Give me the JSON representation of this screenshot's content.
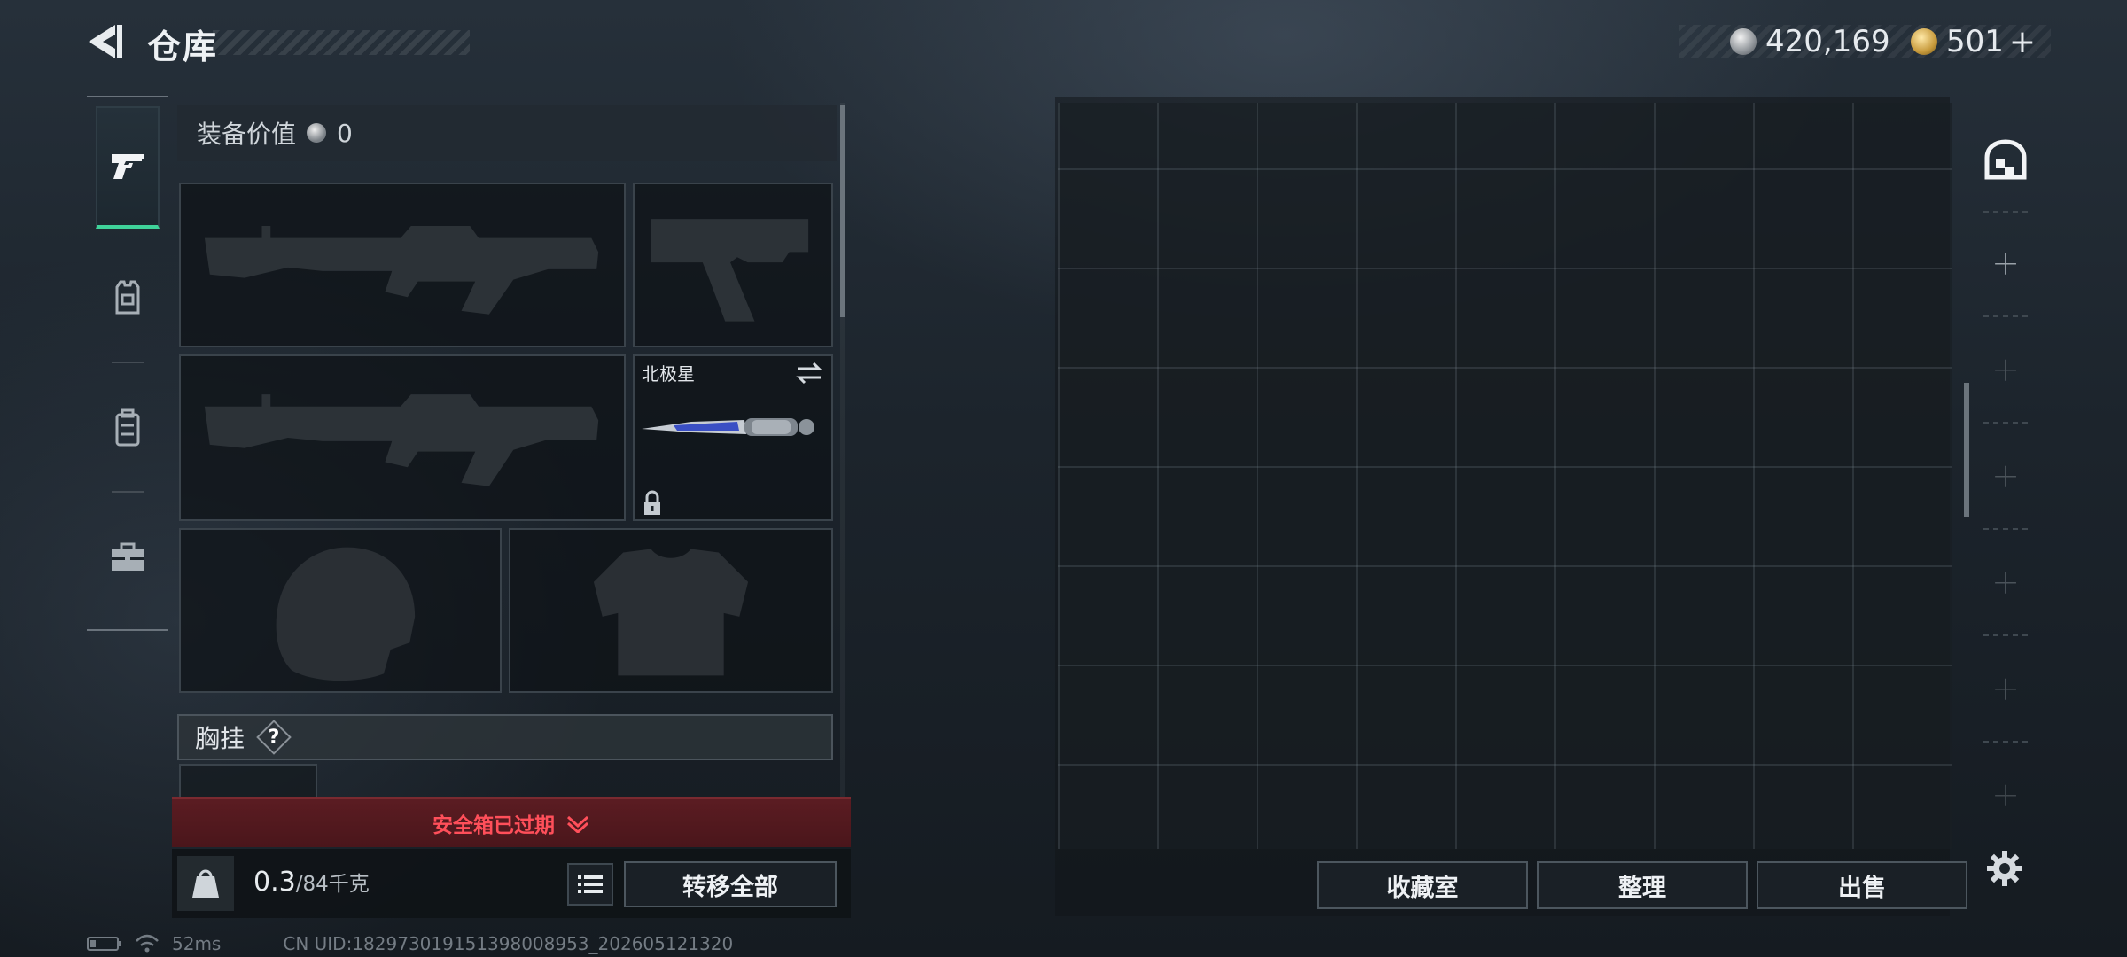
{
  "header": {
    "title": "仓库",
    "currencies": [
      {
        "icon": "silver-coin-icon",
        "amount": "420,169"
      },
      {
        "icon": "gold-coin-icon",
        "amount": "501",
        "suffix": "+"
      }
    ]
  },
  "loadout": {
    "equipment_value_label": "装备价值",
    "equipment_value": "0",
    "melee_name": "北极星",
    "chest_rig_label": "胸挂",
    "chest_help": "?",
    "secure_case_expired": "安全箱已过期",
    "weight_current": "0.3",
    "weight_max": "/84千克",
    "weight_unit_icon_text": "KG",
    "transfer_all": "转移全部"
  },
  "storage": {
    "collection_room": "收藏室",
    "sort": "整理",
    "sell": "出售"
  },
  "status": {
    "ping": "52ms",
    "uid": "CN UID:182973019151398008953_202605121320"
  },
  "colors": {
    "accent_green": "#3fd39a",
    "expired_red": "#ff4f5a",
    "expired_banner_bg": "#5b1c22"
  }
}
